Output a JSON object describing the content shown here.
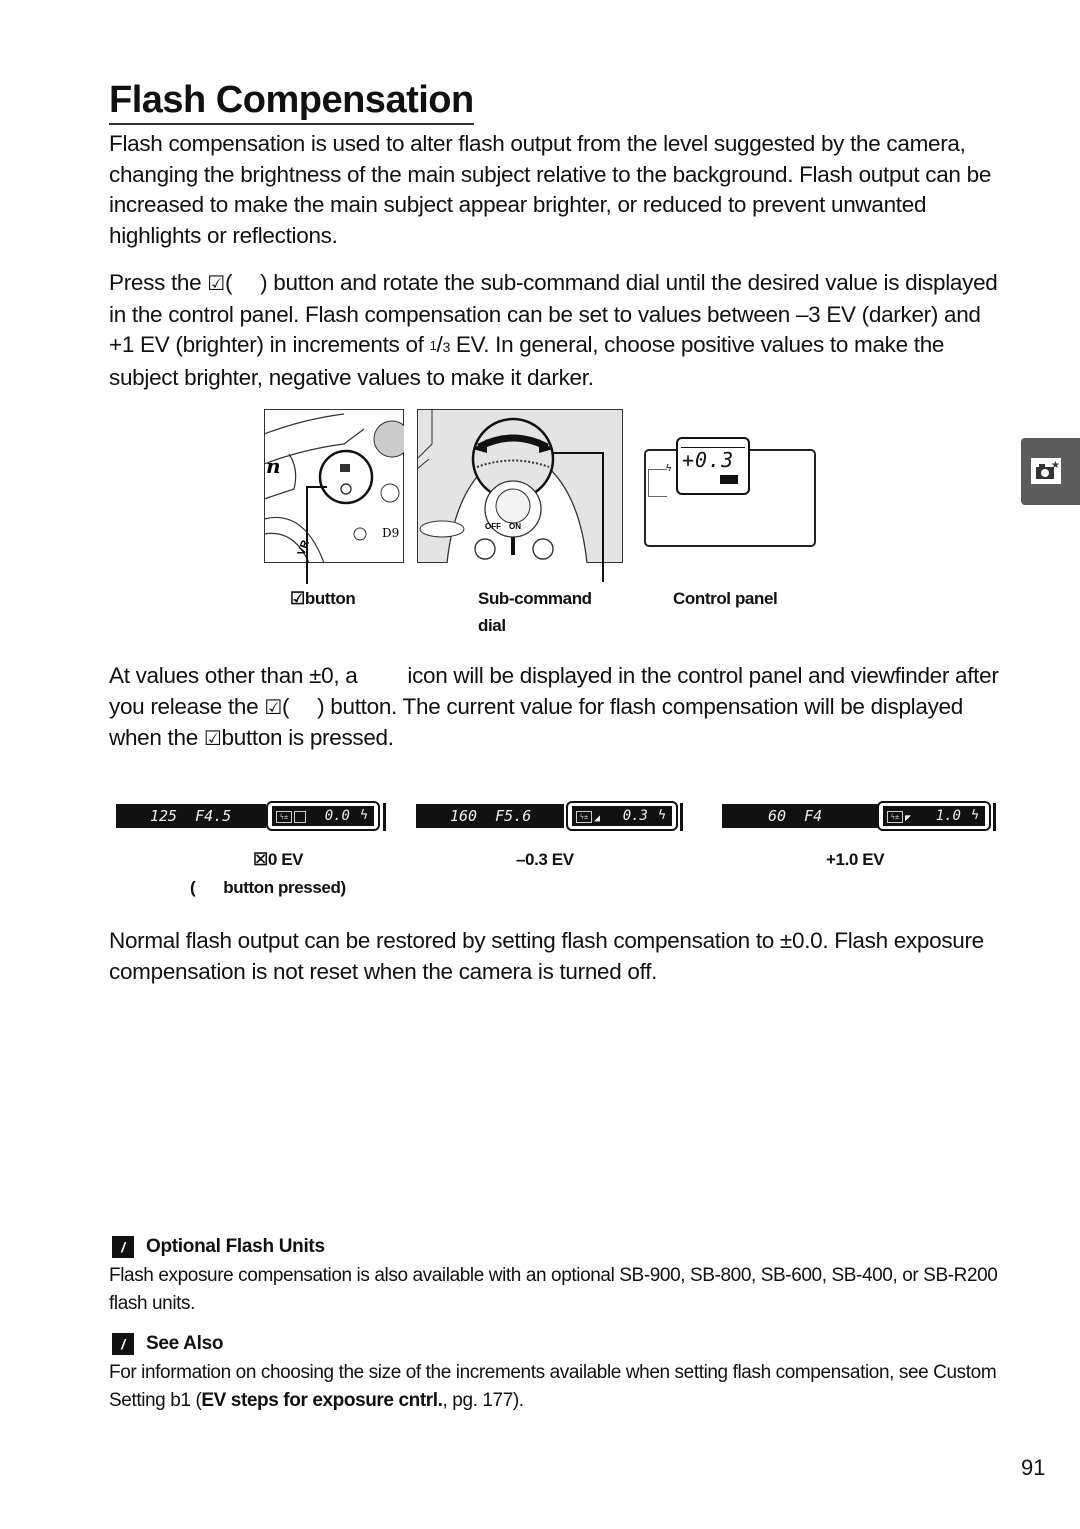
{
  "page": {
    "title": "Flash Compensation",
    "page_number": "91",
    "side_tab_icon": "camera-shooting-icon"
  },
  "paragraphs": {
    "intro": "Flash compensation is used to alter flash output from the level suggested by the camera, changing the brightness of the main subject relative to the background. Flash output can be increased to make the main subject appear brighter, or reduced to prevent unwanted highlights or reflections.",
    "press_a": "Press the ",
    "press_sym": "☑",
    "press_b": "(",
    "press_c": ") button and rotate the sub-command dial until the desired value is displayed in the control panel.  Flash compensation can be set to values between –3 EV (darker) and +1 EV (brighter) in increments of ",
    "frac_num": "1",
    "frac_den": "3",
    "press_d": " EV.  In general, choose positive values to make the subject brighter, negative values to make it darker.",
    "values_a": "At values other than ±0, a ",
    "values_b": " icon will be displayed in the control panel and viewfinder after you release the ",
    "values_sym": "☑",
    "values_c": "(",
    "values_d": ") button.  The current value for flash compensation will be displayed when the ",
    "values_e": "button is pressed.",
    "restore": "Normal flash output can be restored by setting flash compensation to ±0.0.  Flash exposure compensation is not reset when the camera is turned off."
  },
  "figure_top": {
    "captions": {
      "button": "button",
      "button_sym": "☑",
      "dial_line1": "Sub-command",
      "dial_line2": "dial",
      "panel": "Control panel"
    },
    "control_panel_value": "+0.3",
    "camera_dial_labels": [
      "OFF",
      "ON"
    ],
    "camera_model_text": "D9"
  },
  "viewfinder_examples": [
    {
      "shutter": "125",
      "aperture": "F4.5",
      "comp_value": "0.0",
      "label": "☒0 EV",
      "sublabel_open": "(",
      "sublabel": "button pressed)"
    },
    {
      "shutter": "160",
      "aperture": "F5.6",
      "comp_value": "0.3",
      "label": "–0.3 EV"
    },
    {
      "shutter": "60",
      "aperture": "F4",
      "comp_value": "1.0",
      "label": "+1.0 EV"
    }
  ],
  "notes": [
    {
      "heading": "Optional Flash Units",
      "body": "Flash exposure compensation is also available with an optional SB-900, SB-800, SB-600, SB-400, or SB-R200 flash units."
    },
    {
      "heading": "See Also",
      "body_a": "For information on choosing the size of the increments available when setting flash compensation, see Custom Setting b1 (",
      "body_bold": "EV steps for exposure cntrl.",
      "body_b": ", pg. 177)."
    }
  ]
}
